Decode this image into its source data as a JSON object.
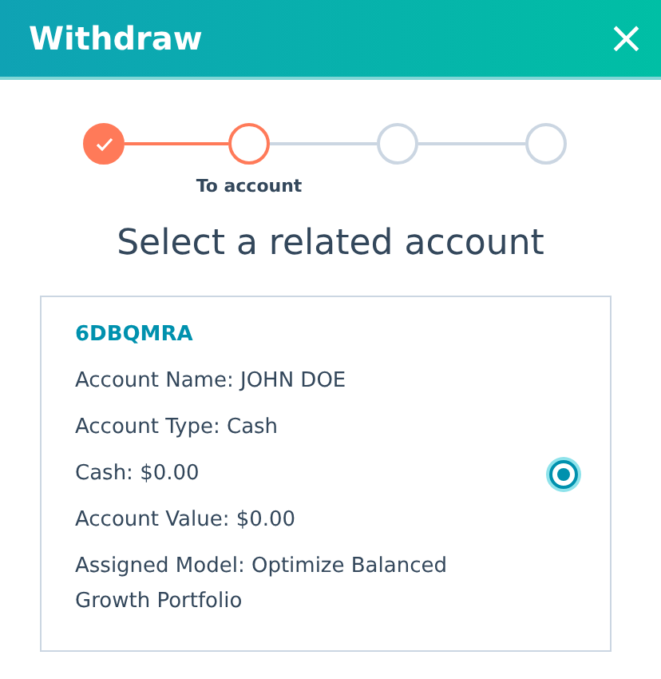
{
  "window": {
    "title": "Withdraw",
    "close": "×"
  },
  "steps": [
    {
      "completed": true,
      "selected": false
    },
    {
      "completed": false,
      "selected": true,
      "label": "To account"
    },
    {
      "completed": false,
      "selected": false
    },
    {
      "completed": false,
      "selected": false
    }
  ],
  "heading": "Select a related account",
  "accounts": [
    {
      "id": "6DBQMRA",
      "selected": true,
      "details": [
        "Account Name: JOHN DOE",
        "Account Type: Cash",
        "Cash: $0.00",
        "Account Value: $0.00",
        "Assigned Model: Optimize Balanced Growth Portfolio"
      ]
    }
  ]
}
